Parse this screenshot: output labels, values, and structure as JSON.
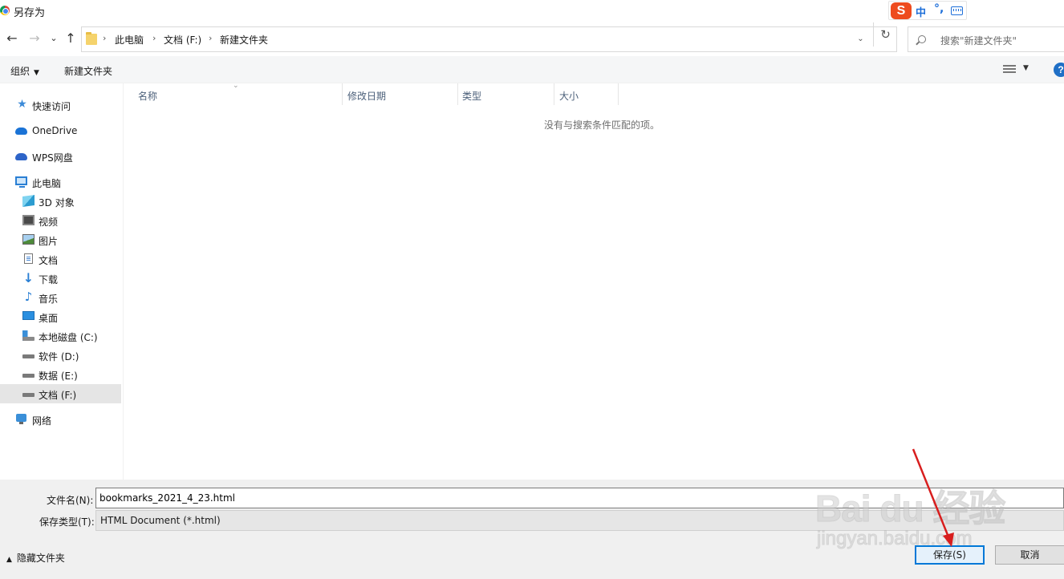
{
  "window": {
    "title": "另存为"
  },
  "ime": {
    "logo": "S",
    "mode": "中",
    "punct": "°,"
  },
  "nav": {
    "back": "←",
    "forward": "→",
    "recent": "⌄",
    "up": "↑"
  },
  "address": {
    "crumbs": [
      "此电脑",
      "文档 (F:)",
      "新建文件夹"
    ],
    "separator": "›",
    "dropdown": "⌄",
    "refresh": "↻"
  },
  "search": {
    "placeholder": "搜索\"新建文件夹\""
  },
  "toolbar": {
    "organize": "组织",
    "new_folder": "新建文件夹",
    "help": "?"
  },
  "sidebar": {
    "items": [
      {
        "label": "快速访问",
        "icon": "star-icon"
      },
      {
        "label": "OneDrive",
        "icon": "cloud-icon"
      },
      {
        "label": "WPS网盘",
        "icon": "wps-cloud-icon"
      },
      {
        "label": "此电脑",
        "icon": "computer-icon"
      },
      {
        "label": "3D 对象",
        "icon": "cube-icon"
      },
      {
        "label": "视频",
        "icon": "video-icon"
      },
      {
        "label": "图片",
        "icon": "picture-icon"
      },
      {
        "label": "文档",
        "icon": "document-icon"
      },
      {
        "label": "下载",
        "icon": "download-icon"
      },
      {
        "label": "音乐",
        "icon": "music-icon"
      },
      {
        "label": "桌面",
        "icon": "desktop-icon"
      },
      {
        "label": "本地磁盘 (C:)",
        "icon": "system-drive-icon"
      },
      {
        "label": "软件 (D:)",
        "icon": "drive-icon"
      },
      {
        "label": "数据 (E:)",
        "icon": "drive-icon"
      },
      {
        "label": "文档 (F:)",
        "icon": "drive-icon",
        "selected": true
      },
      {
        "label": "网络",
        "icon": "network-icon"
      }
    ]
  },
  "filelist": {
    "columns": [
      "名称",
      "修改日期",
      "类型",
      "大小"
    ],
    "empty_message": "没有与搜索条件匹配的项。"
  },
  "save_panel": {
    "filename_label": "文件名(N):",
    "filename_value": "bookmarks_2021_4_23.html",
    "filetype_label": "保存类型(T):",
    "filetype_value": "HTML Document (*.html)",
    "hide_folders": "隐藏文件夹",
    "save_button": "保存(S)",
    "cancel_button": "取消"
  },
  "watermark": {
    "brand": "Bai du 经验",
    "url": "jingyan.baidu.com"
  },
  "colors": {
    "accent": "#0078d7",
    "selected_bg": "#e5e5e5",
    "annotation_arrow": "#d81e1e"
  }
}
